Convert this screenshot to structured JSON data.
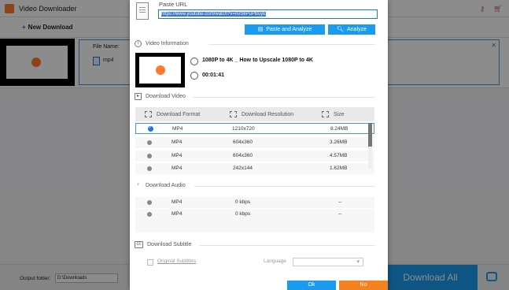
{
  "app": {
    "title": "Video Downloader",
    "new_download_label": "New Download",
    "file_name_label": "File Name:",
    "file_ext": "mp4",
    "output_folder_label": "Output folder:",
    "output_folder_value": "D:\\Downloads",
    "download_all_label": "Download All"
  },
  "dialog": {
    "paste_url_label": "Paste URL",
    "url_value": "https://www.youtube.com/watch?v=nvS6PuPBuyE",
    "paste_analyze_label": "Paste and Analyze",
    "analyze_label": "Analyze",
    "video_info_label": "Video Information",
    "video_title": "1080P to 4K _ How to Upscale 1080P to 4K",
    "video_duration": "00:01:41",
    "download_video_label": "Download Video",
    "video_columns": [
      "Download Format",
      "Download Resolution",
      "Size"
    ],
    "video_rows": [
      {
        "format": "MP4",
        "resolution": "1210x720",
        "size": "8.24MB",
        "selected": true
      },
      {
        "format": "MP4",
        "resolution": "604x360",
        "size": "3.26MB",
        "selected": false
      },
      {
        "format": "MP4",
        "resolution": "604x360",
        "size": "4.57MB",
        "selected": false
      },
      {
        "format": "MP4",
        "resolution": "242x144",
        "size": "1.62MB",
        "selected": false
      }
    ],
    "download_audio_label": "Download Audio",
    "audio_rows": [
      {
        "format": "MP4",
        "bitrate": "0 kbps",
        "size": "--"
      },
      {
        "format": "MP4",
        "bitrate": "0 kbps",
        "size": "--"
      }
    ],
    "download_subtitle_label": "Download Subtitle",
    "original_subtitles_label": "Original Subtitles",
    "language_label": "Language",
    "ok_label": "Ok",
    "no_label": "No"
  },
  "colors": {
    "accent": "#1a9bf0",
    "orange": "#f5821f",
    "selection": "#4a90e2"
  }
}
